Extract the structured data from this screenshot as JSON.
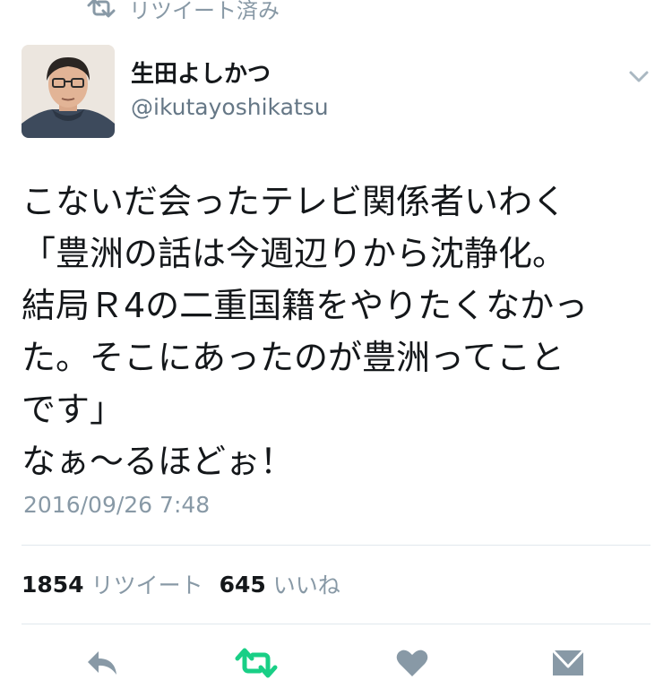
{
  "retweet_banner": {
    "label": "リツイート済み"
  },
  "author": {
    "display_name": "生田よしかつ",
    "handle": "@ikutayoshikatsu"
  },
  "tweet": {
    "lines": [
      "こないだ会ったテレビ関係者いわく",
      "「豊洲の話は今週辺りから沈静化。",
      "結局Ｒ4の二重国籍をやりたくなかっ",
      "た。そこにあったのが豊洲ってこと",
      "です」",
      "なぁ〜るほどぉ！"
    ],
    "timestamp": "2016/09/26 7:48"
  },
  "stats": {
    "retweet_count": "1854",
    "retweet_label": "リツイート",
    "like_count": "645",
    "like_label": "いいね"
  },
  "colors": {
    "retweet_active": "#19cf86",
    "icon_gray": "#8899a6",
    "text_primary": "#14171a",
    "text_secondary": "#657786"
  },
  "icons": {
    "banner": "retweet-icon",
    "more": "chevron-down-icon",
    "reply": "reply-icon",
    "retweet": "retweet-icon",
    "like": "heart-icon",
    "dm": "envelope-icon"
  }
}
